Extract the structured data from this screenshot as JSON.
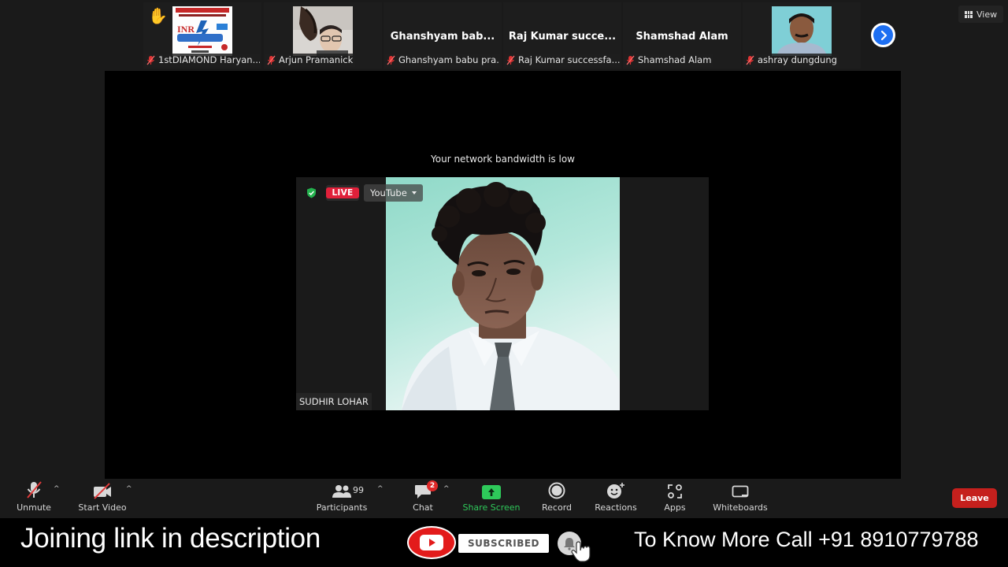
{
  "participants_strip": {
    "tiles": [
      {
        "label": "1stDIAMOND Haryan...",
        "display_name": "",
        "has_video_thumbnail": true,
        "raised_hand": true,
        "muted": true
      },
      {
        "label": "Arjun Pramanick",
        "display_name": "",
        "has_video_thumbnail": true,
        "raised_hand": false,
        "muted": true
      },
      {
        "label": "Ghanshyam babu pra...",
        "display_name": "Ghanshyam  bab...",
        "has_video_thumbnail": false,
        "raised_hand": false,
        "muted": true
      },
      {
        "label": "Raj Kumar successfa...",
        "display_name": "Raj Kumar succe...",
        "has_video_thumbnail": false,
        "raised_hand": false,
        "muted": true
      },
      {
        "label": "Shamshad Alam",
        "display_name": "Shamshad Alam",
        "has_video_thumbnail": false,
        "raised_hand": false,
        "muted": true
      },
      {
        "label": "ashray dungdung",
        "display_name": "",
        "has_video_thumbnail": true,
        "raised_hand": false,
        "muted": true
      }
    ],
    "raised_hand_icon": "✋",
    "next_page_icon": "chevron-right-icon",
    "view_label": "View"
  },
  "stage": {
    "notice": "Your network bandwidth is low",
    "live_badge": "LIVE",
    "stream_target": "YouTube",
    "speaker_name": "SUDHIR LOHAR"
  },
  "toolbar": {
    "unmute": "Unmute",
    "start_video": "Start Video",
    "participants": "Participants",
    "participants_count": "99",
    "chat": "Chat",
    "chat_unread": "2",
    "share_screen": "Share Screen",
    "record": "Record",
    "reactions": "Reactions",
    "apps": "Apps",
    "whiteboards": "Whiteboards",
    "leave": "Leave",
    "caret": "^"
  },
  "banner": {
    "left_text": "Joining link in description",
    "subscribed_label": "SUBSCRIBED",
    "right_text": "To Know More Call +91 8910779788"
  },
  "colors": {
    "share_green": "#2ec95a",
    "leave_red": "#c5201d",
    "live_red": "#e0203a",
    "next_blue": "#1d6ff2",
    "youtube_red": "#e31b1b"
  }
}
